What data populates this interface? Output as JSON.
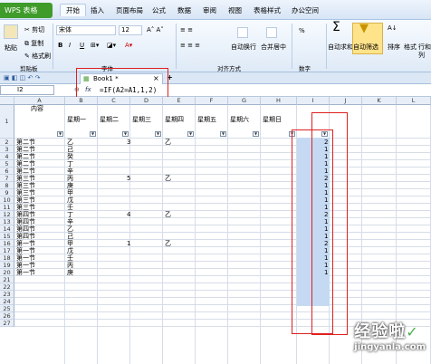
{
  "titlebar": {
    "app_button": "WPS 表格",
    "menus": [
      "开始",
      "插入",
      "页面布局",
      "公式",
      "数据",
      "审阅",
      "视图",
      "表格样式",
      "办公空间"
    ]
  },
  "ribbon": {
    "clipboard": {
      "paste": "粘贴",
      "cut": "剪切",
      "copy": "复制",
      "format_painter": "格式刷",
      "label": "剪贴板"
    },
    "font": {
      "name": "宋体",
      "size": "12",
      "bold": "B",
      "italic": "I",
      "underline": "U",
      "label": "字体"
    },
    "align": {
      "wrap": "自动换行",
      "merge": "合并居中",
      "label": "对齐方式"
    },
    "number": {
      "percent": "%",
      "label": "数字"
    },
    "editing": {
      "autosum": "自动求和",
      "autofilter": "自动筛选",
      "sort": "排序",
      "format": "格式",
      "rowcol": "行和列"
    }
  },
  "tabbar": {
    "workbook_tab": "Book1 *",
    "close": "×",
    "add": "+"
  },
  "formulabar": {
    "name_box": "I2",
    "fx": "fx",
    "formula": "=IF(A2=A1,1,2)"
  },
  "columns": [
    "A",
    "B",
    "C",
    "D",
    "E",
    "F",
    "G",
    "H",
    "I",
    "J",
    "K",
    "L"
  ],
  "rows": [
    "1",
    "2",
    "3",
    "4",
    "5",
    "6",
    "7",
    "8",
    "9",
    "10",
    "11",
    "12",
    "13",
    "14",
    "15",
    "16",
    "17",
    "18",
    "19",
    "20",
    "21",
    "22",
    "23",
    "24",
    "25",
    "26",
    "27"
  ],
  "sheet": {
    "header": {
      "content": "内容",
      "days": [
        "星期一",
        "星期二",
        "星期三",
        "星期四",
        "星期五",
        "星期六",
        "星期日"
      ]
    },
    "col_a": [
      "第二节",
      "第二节",
      "第二节",
      "第二节",
      "第二节",
      "第三节",
      "第三节",
      "第三节",
      "第三节",
      "第三节",
      "第四节",
      "第四节",
      "第四节",
      "第四节",
      "第一节",
      "第一节",
      "第一节",
      "第一节",
      "第一节"
    ],
    "col_b": [
      "乙",
      "己",
      "癸",
      "丁",
      "辛",
      "丙",
      "庚",
      "甲",
      "戊",
      "壬",
      "丁",
      "辛",
      "乙",
      "己",
      "甲",
      "戊",
      "壬",
      "丙",
      "庚"
    ],
    "col_c": {
      "r2": "3",
      "r7": "5",
      "r12": "4",
      "r16": "1"
    },
    "col_e": {
      "r2": "乙",
      "r7": "乙",
      "r12": "乙",
      "r16": "乙"
    },
    "col_i": [
      "2",
      "1",
      "1",
      "1",
      "1",
      "2",
      "1",
      "1",
      "1",
      "1",
      "2",
      "1",
      "1",
      "1",
      "2",
      "1",
      "1",
      "1",
      "1"
    ]
  },
  "watermark": {
    "title": "经验啦",
    "url": "jingyanla.com",
    "check": "✓"
  },
  "colors": {
    "selection": "#c5daf2",
    "highlight": "#e02020",
    "wps_green": "#3f9b2a"
  }
}
